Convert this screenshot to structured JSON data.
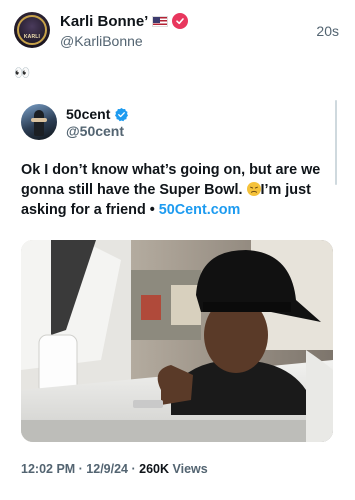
{
  "outer": {
    "name": "Karli Bonne’",
    "handle": "@KarliBonne",
    "time": "20s",
    "avatar_text": "KARLI",
    "body": "👀"
  },
  "quote": {
    "name": "50cent",
    "handle": "@50cent",
    "text_main": "Ok I don’t know what’s going on, but are we gonna still have the Super Bowl. ",
    "text_after_emoji": "I’m just asking for a friend • ",
    "link": "50Cent.com",
    "meta_time": "12:02 PM · 12/9/24 · ",
    "views_count": "260K",
    "views_label": " Views"
  },
  "colors": {
    "verified_blue": "#1d9bf0",
    "pink_badge": "#e8365d",
    "secondary_text": "#536471"
  },
  "icons": {
    "flag": "us-flag-icon",
    "badge": "pink-verified-badge-icon",
    "verified": "blue-verified-badge-icon",
    "emoji": "persevering-face-icon"
  }
}
